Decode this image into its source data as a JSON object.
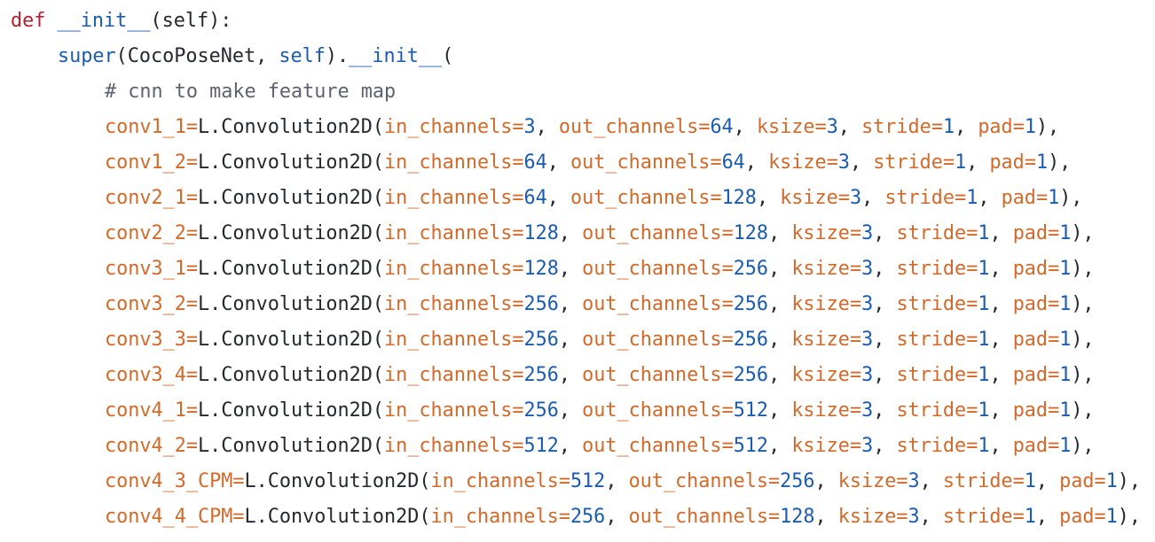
{
  "colors": {
    "keyword": "#b5222d",
    "function": "#1b5cb0",
    "builtin": "#1b5cb0",
    "plain": "#24292e",
    "comment": "#5c6370",
    "param": "#d16a2a",
    "operator": "#d16a2a",
    "number": "#1b5cb0",
    "background": "#ffffff"
  },
  "code_lines": [
    {
      "indent": 0,
      "tokens": [
        {
          "t": "def",
          "c": "kw"
        },
        {
          "t": " ",
          "c": "pl"
        },
        {
          "t": "__init__",
          "c": "fn"
        },
        {
          "t": "(self):",
          "c": "pl"
        }
      ]
    },
    {
      "indent": 1,
      "tokens": [
        {
          "t": "super",
          "c": "bi"
        },
        {
          "t": "(CocoPoseNet, ",
          "c": "pl"
        },
        {
          "t": "self",
          "c": "bi"
        },
        {
          "t": ").",
          "c": "pl"
        },
        {
          "t": "__init__",
          "c": "fn"
        },
        {
          "t": "(",
          "c": "pl"
        }
      ]
    },
    {
      "indent": 2,
      "tokens": [
        {
          "t": "# cnn to make feature map",
          "c": "cm"
        }
      ]
    },
    {
      "indent": 2,
      "tokens": [
        {
          "t": "conv1_1",
          "c": "pn"
        },
        {
          "t": "=",
          "c": "op"
        },
        {
          "t": "L.Convolution2D(",
          "c": "pl"
        },
        {
          "t": "in_channels",
          "c": "pn"
        },
        {
          "t": "=",
          "c": "op"
        },
        {
          "t": "3",
          "c": "nu"
        },
        {
          "t": ", ",
          "c": "pl"
        },
        {
          "t": "out_channels",
          "c": "pn"
        },
        {
          "t": "=",
          "c": "op"
        },
        {
          "t": "64",
          "c": "nu"
        },
        {
          "t": ", ",
          "c": "pl"
        },
        {
          "t": "ksize",
          "c": "pn"
        },
        {
          "t": "=",
          "c": "op"
        },
        {
          "t": "3",
          "c": "nu"
        },
        {
          "t": ", ",
          "c": "pl"
        },
        {
          "t": "stride",
          "c": "pn"
        },
        {
          "t": "=",
          "c": "op"
        },
        {
          "t": "1",
          "c": "nu"
        },
        {
          "t": ", ",
          "c": "pl"
        },
        {
          "t": "pad",
          "c": "pn"
        },
        {
          "t": "=",
          "c": "op"
        },
        {
          "t": "1",
          "c": "nu"
        },
        {
          "t": "),",
          "c": "pl"
        }
      ]
    },
    {
      "indent": 2,
      "tokens": [
        {
          "t": "conv1_2",
          "c": "pn"
        },
        {
          "t": "=",
          "c": "op"
        },
        {
          "t": "L.Convolution2D(",
          "c": "pl"
        },
        {
          "t": "in_channels",
          "c": "pn"
        },
        {
          "t": "=",
          "c": "op"
        },
        {
          "t": "64",
          "c": "nu"
        },
        {
          "t": ", ",
          "c": "pl"
        },
        {
          "t": "out_channels",
          "c": "pn"
        },
        {
          "t": "=",
          "c": "op"
        },
        {
          "t": "64",
          "c": "nu"
        },
        {
          "t": ", ",
          "c": "pl"
        },
        {
          "t": "ksize",
          "c": "pn"
        },
        {
          "t": "=",
          "c": "op"
        },
        {
          "t": "3",
          "c": "nu"
        },
        {
          "t": ", ",
          "c": "pl"
        },
        {
          "t": "stride",
          "c": "pn"
        },
        {
          "t": "=",
          "c": "op"
        },
        {
          "t": "1",
          "c": "nu"
        },
        {
          "t": ", ",
          "c": "pl"
        },
        {
          "t": "pad",
          "c": "pn"
        },
        {
          "t": "=",
          "c": "op"
        },
        {
          "t": "1",
          "c": "nu"
        },
        {
          "t": "),",
          "c": "pl"
        }
      ]
    },
    {
      "indent": 2,
      "tokens": [
        {
          "t": "conv2_1",
          "c": "pn"
        },
        {
          "t": "=",
          "c": "op"
        },
        {
          "t": "L.Convolution2D(",
          "c": "pl"
        },
        {
          "t": "in_channels",
          "c": "pn"
        },
        {
          "t": "=",
          "c": "op"
        },
        {
          "t": "64",
          "c": "nu"
        },
        {
          "t": ", ",
          "c": "pl"
        },
        {
          "t": "out_channels",
          "c": "pn"
        },
        {
          "t": "=",
          "c": "op"
        },
        {
          "t": "128",
          "c": "nu"
        },
        {
          "t": ", ",
          "c": "pl"
        },
        {
          "t": "ksize",
          "c": "pn"
        },
        {
          "t": "=",
          "c": "op"
        },
        {
          "t": "3",
          "c": "nu"
        },
        {
          "t": ", ",
          "c": "pl"
        },
        {
          "t": "stride",
          "c": "pn"
        },
        {
          "t": "=",
          "c": "op"
        },
        {
          "t": "1",
          "c": "nu"
        },
        {
          "t": ", ",
          "c": "pl"
        },
        {
          "t": "pad",
          "c": "pn"
        },
        {
          "t": "=",
          "c": "op"
        },
        {
          "t": "1",
          "c": "nu"
        },
        {
          "t": "),",
          "c": "pl"
        }
      ]
    },
    {
      "indent": 2,
      "tokens": [
        {
          "t": "conv2_2",
          "c": "pn"
        },
        {
          "t": "=",
          "c": "op"
        },
        {
          "t": "L.Convolution2D(",
          "c": "pl"
        },
        {
          "t": "in_channels",
          "c": "pn"
        },
        {
          "t": "=",
          "c": "op"
        },
        {
          "t": "128",
          "c": "nu"
        },
        {
          "t": ", ",
          "c": "pl"
        },
        {
          "t": "out_channels",
          "c": "pn"
        },
        {
          "t": "=",
          "c": "op"
        },
        {
          "t": "128",
          "c": "nu"
        },
        {
          "t": ", ",
          "c": "pl"
        },
        {
          "t": "ksize",
          "c": "pn"
        },
        {
          "t": "=",
          "c": "op"
        },
        {
          "t": "3",
          "c": "nu"
        },
        {
          "t": ", ",
          "c": "pl"
        },
        {
          "t": "stride",
          "c": "pn"
        },
        {
          "t": "=",
          "c": "op"
        },
        {
          "t": "1",
          "c": "nu"
        },
        {
          "t": ", ",
          "c": "pl"
        },
        {
          "t": "pad",
          "c": "pn"
        },
        {
          "t": "=",
          "c": "op"
        },
        {
          "t": "1",
          "c": "nu"
        },
        {
          "t": "),",
          "c": "pl"
        }
      ]
    },
    {
      "indent": 2,
      "tokens": [
        {
          "t": "conv3_1",
          "c": "pn"
        },
        {
          "t": "=",
          "c": "op"
        },
        {
          "t": "L.Convolution2D(",
          "c": "pl"
        },
        {
          "t": "in_channels",
          "c": "pn"
        },
        {
          "t": "=",
          "c": "op"
        },
        {
          "t": "128",
          "c": "nu"
        },
        {
          "t": ", ",
          "c": "pl"
        },
        {
          "t": "out_channels",
          "c": "pn"
        },
        {
          "t": "=",
          "c": "op"
        },
        {
          "t": "256",
          "c": "nu"
        },
        {
          "t": ", ",
          "c": "pl"
        },
        {
          "t": "ksize",
          "c": "pn"
        },
        {
          "t": "=",
          "c": "op"
        },
        {
          "t": "3",
          "c": "nu"
        },
        {
          "t": ", ",
          "c": "pl"
        },
        {
          "t": "stride",
          "c": "pn"
        },
        {
          "t": "=",
          "c": "op"
        },
        {
          "t": "1",
          "c": "nu"
        },
        {
          "t": ", ",
          "c": "pl"
        },
        {
          "t": "pad",
          "c": "pn"
        },
        {
          "t": "=",
          "c": "op"
        },
        {
          "t": "1",
          "c": "nu"
        },
        {
          "t": "),",
          "c": "pl"
        }
      ]
    },
    {
      "indent": 2,
      "tokens": [
        {
          "t": "conv3_2",
          "c": "pn"
        },
        {
          "t": "=",
          "c": "op"
        },
        {
          "t": "L.Convolution2D(",
          "c": "pl"
        },
        {
          "t": "in_channels",
          "c": "pn"
        },
        {
          "t": "=",
          "c": "op"
        },
        {
          "t": "256",
          "c": "nu"
        },
        {
          "t": ", ",
          "c": "pl"
        },
        {
          "t": "out_channels",
          "c": "pn"
        },
        {
          "t": "=",
          "c": "op"
        },
        {
          "t": "256",
          "c": "nu"
        },
        {
          "t": ", ",
          "c": "pl"
        },
        {
          "t": "ksize",
          "c": "pn"
        },
        {
          "t": "=",
          "c": "op"
        },
        {
          "t": "3",
          "c": "nu"
        },
        {
          "t": ", ",
          "c": "pl"
        },
        {
          "t": "stride",
          "c": "pn"
        },
        {
          "t": "=",
          "c": "op"
        },
        {
          "t": "1",
          "c": "nu"
        },
        {
          "t": ", ",
          "c": "pl"
        },
        {
          "t": "pad",
          "c": "pn"
        },
        {
          "t": "=",
          "c": "op"
        },
        {
          "t": "1",
          "c": "nu"
        },
        {
          "t": "),",
          "c": "pl"
        }
      ]
    },
    {
      "indent": 2,
      "tokens": [
        {
          "t": "conv3_3",
          "c": "pn"
        },
        {
          "t": "=",
          "c": "op"
        },
        {
          "t": "L.Convolution2D(",
          "c": "pl"
        },
        {
          "t": "in_channels",
          "c": "pn"
        },
        {
          "t": "=",
          "c": "op"
        },
        {
          "t": "256",
          "c": "nu"
        },
        {
          "t": ", ",
          "c": "pl"
        },
        {
          "t": "out_channels",
          "c": "pn"
        },
        {
          "t": "=",
          "c": "op"
        },
        {
          "t": "256",
          "c": "nu"
        },
        {
          "t": ", ",
          "c": "pl"
        },
        {
          "t": "ksize",
          "c": "pn"
        },
        {
          "t": "=",
          "c": "op"
        },
        {
          "t": "3",
          "c": "nu"
        },
        {
          "t": ", ",
          "c": "pl"
        },
        {
          "t": "stride",
          "c": "pn"
        },
        {
          "t": "=",
          "c": "op"
        },
        {
          "t": "1",
          "c": "nu"
        },
        {
          "t": ", ",
          "c": "pl"
        },
        {
          "t": "pad",
          "c": "pn"
        },
        {
          "t": "=",
          "c": "op"
        },
        {
          "t": "1",
          "c": "nu"
        },
        {
          "t": "),",
          "c": "pl"
        }
      ]
    },
    {
      "indent": 2,
      "tokens": [
        {
          "t": "conv3_4",
          "c": "pn"
        },
        {
          "t": "=",
          "c": "op"
        },
        {
          "t": "L.Convolution2D(",
          "c": "pl"
        },
        {
          "t": "in_channels",
          "c": "pn"
        },
        {
          "t": "=",
          "c": "op"
        },
        {
          "t": "256",
          "c": "nu"
        },
        {
          "t": ", ",
          "c": "pl"
        },
        {
          "t": "out_channels",
          "c": "pn"
        },
        {
          "t": "=",
          "c": "op"
        },
        {
          "t": "256",
          "c": "nu"
        },
        {
          "t": ", ",
          "c": "pl"
        },
        {
          "t": "ksize",
          "c": "pn"
        },
        {
          "t": "=",
          "c": "op"
        },
        {
          "t": "3",
          "c": "nu"
        },
        {
          "t": ", ",
          "c": "pl"
        },
        {
          "t": "stride",
          "c": "pn"
        },
        {
          "t": "=",
          "c": "op"
        },
        {
          "t": "1",
          "c": "nu"
        },
        {
          "t": ", ",
          "c": "pl"
        },
        {
          "t": "pad",
          "c": "pn"
        },
        {
          "t": "=",
          "c": "op"
        },
        {
          "t": "1",
          "c": "nu"
        },
        {
          "t": "),",
          "c": "pl"
        }
      ]
    },
    {
      "indent": 2,
      "tokens": [
        {
          "t": "conv4_1",
          "c": "pn"
        },
        {
          "t": "=",
          "c": "op"
        },
        {
          "t": "L.Convolution2D(",
          "c": "pl"
        },
        {
          "t": "in_channels",
          "c": "pn"
        },
        {
          "t": "=",
          "c": "op"
        },
        {
          "t": "256",
          "c": "nu"
        },
        {
          "t": ", ",
          "c": "pl"
        },
        {
          "t": "out_channels",
          "c": "pn"
        },
        {
          "t": "=",
          "c": "op"
        },
        {
          "t": "512",
          "c": "nu"
        },
        {
          "t": ", ",
          "c": "pl"
        },
        {
          "t": "ksize",
          "c": "pn"
        },
        {
          "t": "=",
          "c": "op"
        },
        {
          "t": "3",
          "c": "nu"
        },
        {
          "t": ", ",
          "c": "pl"
        },
        {
          "t": "stride",
          "c": "pn"
        },
        {
          "t": "=",
          "c": "op"
        },
        {
          "t": "1",
          "c": "nu"
        },
        {
          "t": ", ",
          "c": "pl"
        },
        {
          "t": "pad",
          "c": "pn"
        },
        {
          "t": "=",
          "c": "op"
        },
        {
          "t": "1",
          "c": "nu"
        },
        {
          "t": "),",
          "c": "pl"
        }
      ]
    },
    {
      "indent": 2,
      "tokens": [
        {
          "t": "conv4_2",
          "c": "pn"
        },
        {
          "t": "=",
          "c": "op"
        },
        {
          "t": "L.Convolution2D(",
          "c": "pl"
        },
        {
          "t": "in_channels",
          "c": "pn"
        },
        {
          "t": "=",
          "c": "op"
        },
        {
          "t": "512",
          "c": "nu"
        },
        {
          "t": ", ",
          "c": "pl"
        },
        {
          "t": "out_channels",
          "c": "pn"
        },
        {
          "t": "=",
          "c": "op"
        },
        {
          "t": "512",
          "c": "nu"
        },
        {
          "t": ", ",
          "c": "pl"
        },
        {
          "t": "ksize",
          "c": "pn"
        },
        {
          "t": "=",
          "c": "op"
        },
        {
          "t": "3",
          "c": "nu"
        },
        {
          "t": ", ",
          "c": "pl"
        },
        {
          "t": "stride",
          "c": "pn"
        },
        {
          "t": "=",
          "c": "op"
        },
        {
          "t": "1",
          "c": "nu"
        },
        {
          "t": ", ",
          "c": "pl"
        },
        {
          "t": "pad",
          "c": "pn"
        },
        {
          "t": "=",
          "c": "op"
        },
        {
          "t": "1",
          "c": "nu"
        },
        {
          "t": "),",
          "c": "pl"
        }
      ]
    },
    {
      "indent": 2,
      "tokens": [
        {
          "t": "conv4_3_CPM",
          "c": "pn"
        },
        {
          "t": "=",
          "c": "op"
        },
        {
          "t": "L.Convolution2D(",
          "c": "pl"
        },
        {
          "t": "in_channels",
          "c": "pn"
        },
        {
          "t": "=",
          "c": "op"
        },
        {
          "t": "512",
          "c": "nu"
        },
        {
          "t": ", ",
          "c": "pl"
        },
        {
          "t": "out_channels",
          "c": "pn"
        },
        {
          "t": "=",
          "c": "op"
        },
        {
          "t": "256",
          "c": "nu"
        },
        {
          "t": ", ",
          "c": "pl"
        },
        {
          "t": "ksize",
          "c": "pn"
        },
        {
          "t": "=",
          "c": "op"
        },
        {
          "t": "3",
          "c": "nu"
        },
        {
          "t": ", ",
          "c": "pl"
        },
        {
          "t": "stride",
          "c": "pn"
        },
        {
          "t": "=",
          "c": "op"
        },
        {
          "t": "1",
          "c": "nu"
        },
        {
          "t": ", ",
          "c": "pl"
        },
        {
          "t": "pad",
          "c": "pn"
        },
        {
          "t": "=",
          "c": "op"
        },
        {
          "t": "1",
          "c": "nu"
        },
        {
          "t": "),",
          "c": "pl"
        }
      ]
    },
    {
      "indent": 2,
      "tokens": [
        {
          "t": "conv4_4_CPM",
          "c": "pn"
        },
        {
          "t": "=",
          "c": "op"
        },
        {
          "t": "L.Convolution2D(",
          "c": "pl"
        },
        {
          "t": "in_channels",
          "c": "pn"
        },
        {
          "t": "=",
          "c": "op"
        },
        {
          "t": "256",
          "c": "nu"
        },
        {
          "t": ", ",
          "c": "pl"
        },
        {
          "t": "out_channels",
          "c": "pn"
        },
        {
          "t": "=",
          "c": "op"
        },
        {
          "t": "128",
          "c": "nu"
        },
        {
          "t": ", ",
          "c": "pl"
        },
        {
          "t": "ksize",
          "c": "pn"
        },
        {
          "t": "=",
          "c": "op"
        },
        {
          "t": "3",
          "c": "nu"
        },
        {
          "t": ", ",
          "c": "pl"
        },
        {
          "t": "stride",
          "c": "pn"
        },
        {
          "t": "=",
          "c": "op"
        },
        {
          "t": "1",
          "c": "nu"
        },
        {
          "t": ", ",
          "c": "pl"
        },
        {
          "t": "pad",
          "c": "pn"
        },
        {
          "t": "=",
          "c": "op"
        },
        {
          "t": "1",
          "c": "nu"
        },
        {
          "t": "),",
          "c": "pl"
        }
      ]
    }
  ]
}
